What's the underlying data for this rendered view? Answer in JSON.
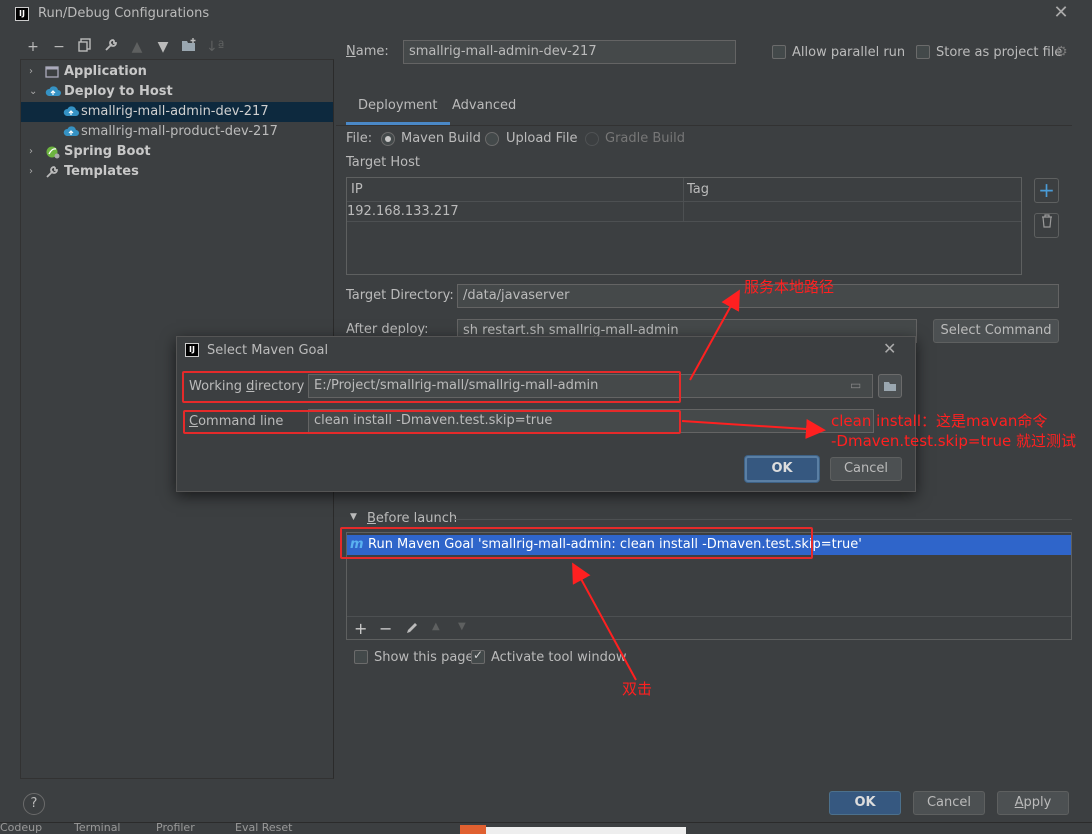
{
  "window": {
    "title": "Run/Debug Configurations"
  },
  "toolbar": {
    "buttons": [
      "add-icon",
      "remove-icon",
      "copy-icon",
      "wrench-icon",
      "move-up-icon",
      "move-down-icon",
      "folder-add-icon",
      "sort-icon"
    ]
  },
  "tree": {
    "items": [
      {
        "label": "Application",
        "level": 0,
        "expanded": false,
        "icon": "application-icon"
      },
      {
        "label": "Deploy to Host",
        "level": 0,
        "expanded": true,
        "icon": "cloud-deploy-icon"
      },
      {
        "label": "smallrig-mall-admin-dev-217",
        "level": 1,
        "selected": true,
        "icon": "cloud-deploy-icon"
      },
      {
        "label": "smallrig-mall-product-dev-217",
        "level": 1,
        "icon": "cloud-deploy-icon"
      },
      {
        "label": "Spring Boot",
        "level": 0,
        "expanded": false,
        "icon": "spring-boot-icon"
      },
      {
        "label": "Templates",
        "level": 0,
        "expanded": false,
        "icon": "wrench-icon"
      }
    ]
  },
  "config": {
    "name_label": "Name:",
    "name_value": "smallrig-mall-admin-dev-217",
    "allow_parallel_label": "Allow parallel run",
    "store_as_project_label": "Store as project file"
  },
  "tabs": [
    {
      "label": "Deployment",
      "active": true
    },
    {
      "label": "Advanced",
      "active": false
    }
  ],
  "deployment": {
    "file_label": "File:",
    "file_options": [
      {
        "label": "Maven Build",
        "selected": true,
        "disabled": false
      },
      {
        "label": "Upload File",
        "selected": false,
        "disabled": false
      },
      {
        "label": "Gradle Build",
        "selected": false,
        "disabled": true
      }
    ],
    "target_host_label": "Target Host",
    "host_table": {
      "columns": [
        "IP",
        "Tag"
      ],
      "rows": [
        [
          "192.168.133.217",
          ""
        ]
      ]
    },
    "target_dir_label": "Target Directory:",
    "target_dir_value": "/data/javaserver",
    "after_deploy_label": "After deploy:",
    "after_deploy_value": "sh restart.sh smallrig-mall-admin",
    "select_command_label": "Select Command"
  },
  "before_launch": {
    "label": "Before launch",
    "item": "Run Maven Goal 'smallrig-mall-admin: clean install -Dmaven.test.skip=true'",
    "show_this_page_label": "Show this page",
    "activate_tool_window_label": "Activate tool window"
  },
  "maven_dialog": {
    "title": "Select Maven Goal",
    "working_dir_label": "Working directory",
    "working_dir_value": "E:/Project/smallrig-mall/smallrig-mall-admin",
    "command_line_label": "Command line",
    "command_line_value": "clean install -Dmaven.test.skip=true",
    "ok_label": "OK",
    "cancel_label": "Cancel"
  },
  "footer": {
    "ok_label": "OK",
    "cancel_label": "Cancel",
    "apply_label": "Apply",
    "help_label": "?"
  },
  "bottom_strip": {
    "items": [
      "Codeup",
      "Terminal",
      "Profiler",
      "Eval Reset"
    ]
  },
  "annotations": {
    "local_path_note": "服务本地路径",
    "clean_install_note": "clean install：这是mavan命令",
    "skip_test_note": "-Dmaven.test.skip=true 就过测试",
    "double_click_note": "双击"
  },
  "colors": {
    "annotation_red": "#ff2020",
    "selection_blue": "#2f65ca",
    "primary_button": "#365880"
  }
}
